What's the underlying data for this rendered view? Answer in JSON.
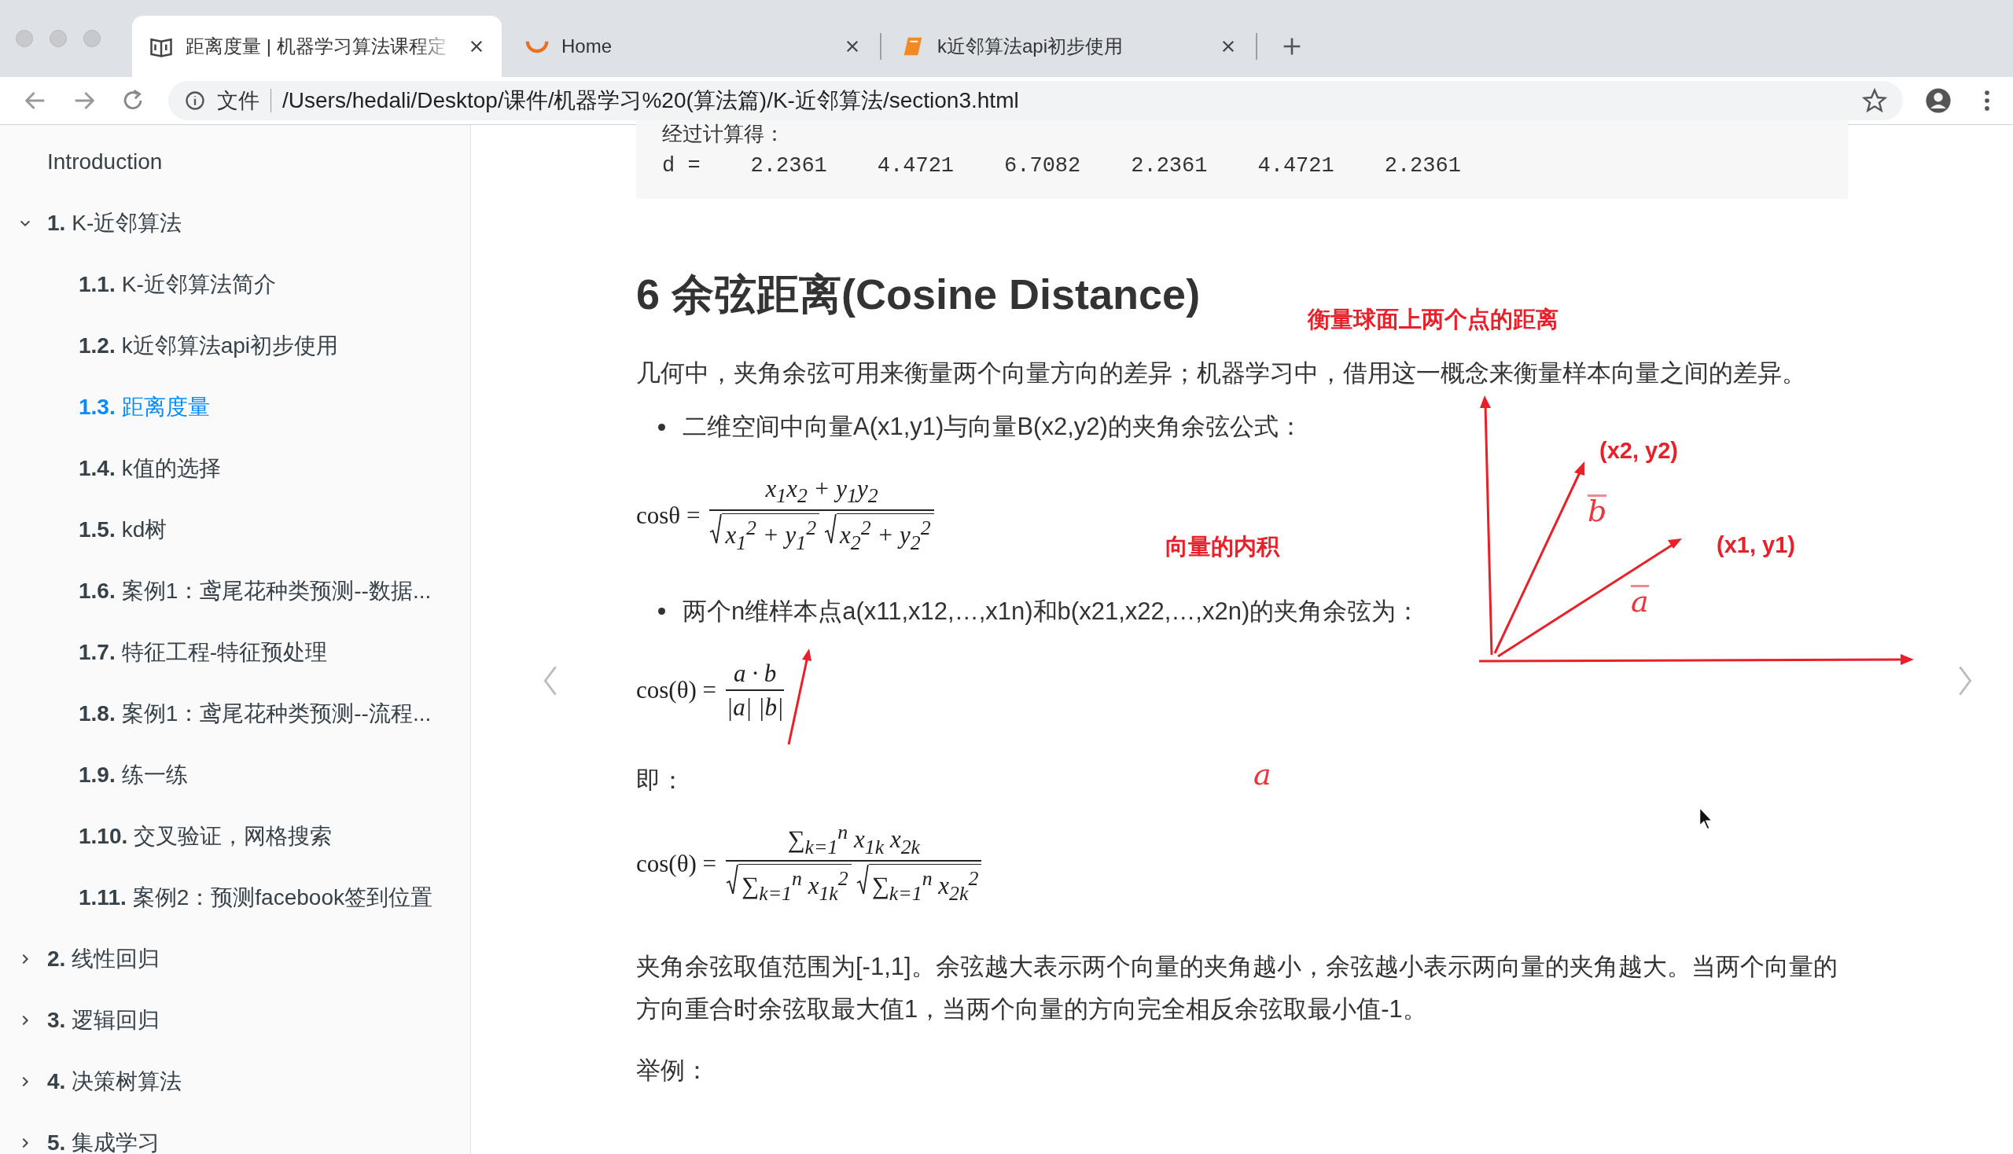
{
  "browser": {
    "tabs": [
      {
        "title": "距离度量 | 机器学习算法课程定",
        "selected": true,
        "kind": "book"
      },
      {
        "title": "Home",
        "selected": false,
        "kind": "spinner"
      },
      {
        "title": "k近邻算法api初步使用",
        "selected": false,
        "kind": "notebook"
      }
    ],
    "address": {
      "scheme_label": "文件",
      "url": "/Users/hedali/Desktop/课件/机器学习%20(算法篇)/K-近邻算法/section3.html"
    }
  },
  "sidebar": {
    "items": [
      {
        "label": "Introduction",
        "selected": false
      },
      {
        "number": "1.",
        "label": "K-近邻算法",
        "selected": false,
        "expanded": true,
        "children": [
          {
            "number": "1.1.",
            "label": "K-近邻算法简介",
            "selected": false
          },
          {
            "number": "1.2.",
            "label": "k近邻算法api初步使用",
            "selected": false
          },
          {
            "number": "1.3.",
            "label": "距离度量",
            "selected": true
          },
          {
            "number": "1.4.",
            "label": "k值的选择",
            "selected": false
          },
          {
            "number": "1.5.",
            "label": "kd树",
            "selected": false
          },
          {
            "number": "1.6.",
            "label": "案例1：鸢尾花种类预测--数据...",
            "selected": false
          },
          {
            "number": "1.7.",
            "label": "特征工程-特征预处理",
            "selected": false
          },
          {
            "number": "1.8.",
            "label": "案例1：鸢尾花种类预测--流程...",
            "selected": false
          },
          {
            "number": "1.9.",
            "label": "练一练",
            "selected": false
          },
          {
            "number": "1.10.",
            "label": "交叉验证，网格搜索",
            "selected": false
          },
          {
            "number": "1.11.",
            "label": "案例2：预测facebook签到位置",
            "selected": false
          }
        ]
      },
      {
        "number": "2.",
        "label": "线性回归",
        "selected": false,
        "expanded": false
      },
      {
        "number": "3.",
        "label": "逻辑回归",
        "selected": false,
        "expanded": false
      },
      {
        "number": "4.",
        "label": "决策树算法",
        "selected": false,
        "expanded": false
      },
      {
        "number": "5.",
        "label": "集成学习",
        "selected": false,
        "expanded": false
      }
    ]
  },
  "content": {
    "code_block": {
      "caption": "经过计算得：",
      "cells": [
        "d =",
        "2.2361",
        "4.4721",
        "6.7082",
        "2.2361",
        "4.4721",
        "2.2361"
      ]
    },
    "heading": "6 余弦距离(Cosine Distance)",
    "blocks": [
      {
        "kind": "paragraph",
        "text": "几何中，夹角余弦可用来衡量两个向量方向的差异；机器学习中，借用这一概念来衡量样本向量之间的差异。"
      },
      {
        "kind": "bullet",
        "text": "二维空间中向量A(x1,y1)与向量B(x2,y2)的夹角余弦公式："
      },
      {
        "kind": "formula",
        "lhs": "cosθ =",
        "numerator": "x$_{1}$x$_{2}$ + y$_{1}$y$_{2}$",
        "denominator": [
          {
            "radical": true,
            "text": "x$_{1}$$^{2}$ + y$_{1}$$^{2}$"
          },
          {
            "radical": true,
            "text": "x$_{2}$$^{2}$ + y$_{2}$$^{2}$"
          }
        ]
      },
      {
        "kind": "bullet",
        "text": "两个n维样本点a(x11,x12,…,x1n)和b(x21,x22,…,x2n)的夹角余弦为："
      },
      {
        "kind": "formula",
        "lhs": "cos(θ) =",
        "numerator": "a · b",
        "denominator": [
          {
            "radical": false,
            "text": "|a| |b|"
          }
        ]
      },
      {
        "kind": "paragraph",
        "text": "即："
      },
      {
        "kind": "formula",
        "lhs": "cos(θ) =",
        "numerator": "∑$_{k=1}$$^{n}$ x$_{1k}$ x$_{2k}$",
        "denominator": [
          {
            "radical": true,
            "text": "∑$_{k=1}$$^{n}$ x$_{1k}$$^{2}$"
          },
          {
            "radical": true,
            "text": "∑$_{k=1}$$^{n}$ x$_{2k}$$^{2}$"
          }
        ]
      },
      {
        "kind": "paragraph",
        "text": "夹角余弦取值范围为[-1,1]。余弦越大表示两个向量的夹角越小，余弦越小表示两向量的夹角越大。当两个向量的方向重合时余弦取最大值1，当两个向量的方向完全相反余弦取最小值-1。"
      },
      {
        "kind": "paragraph",
        "text": "举例："
      }
    ]
  },
  "annotations": {
    "notes": [
      "衡量球面上两个点的距离",
      "向量的内积"
    ],
    "diagram": {
      "labels": [
        "(x2, y2)",
        "(x1, y1)"
      ],
      "marks": [
        "b",
        "a"
      ]
    },
    "scribble": "a"
  }
}
